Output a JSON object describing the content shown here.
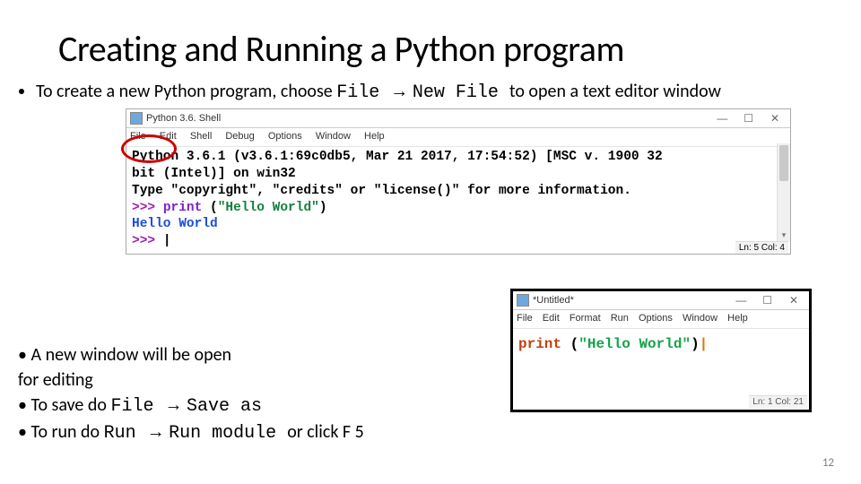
{
  "title": "Creating and Running a Python program",
  "page_number": "12",
  "window_controls": {
    "min": "—",
    "max": "☐",
    "close": "✕"
  },
  "bullets": {
    "top": {
      "prefix": "To create a new Python program, choose ",
      "code1": "File ",
      "arrow": "→",
      "code2": " New File ",
      "suffix": " to open a text editor window"
    },
    "bottom": {
      "0": "A new window will be open",
      "1": "for editing"
    },
    "save": {
      "prefix": "To save do ",
      "code1": "File ",
      "arrow": "→",
      "code2": " Save as"
    },
    "run": {
      "prefix": "To run do ",
      "code1": "Run ",
      "arrow": "→",
      "code2": " Run module ",
      "suffix": " or click F 5"
    }
  },
  "shell": {
    "title": "Python 3.6. Shell",
    "menu": [
      "File",
      "Edit",
      "Shell",
      "Debug",
      "Options",
      "Window",
      "Help"
    ],
    "banner1": "Python 3.6.1 (v3.6.1:69c0db5, Mar 21 2017, 17:54:52) [MSC v. 1900 32",
    "banner2": "bit (Intel)] on win32",
    "banner3": "Type \"copyright\", \"credits\" or \"license()\" for more information.",
    "prompt": ">>>",
    "call_fn": "print",
    "call_open": "(",
    "call_arg": "\"Hello World\"",
    "call_close": ")",
    "output": "Hello World",
    "cursor": "|",
    "status": "Ln: 5  Col: 4"
  },
  "editor": {
    "title": "*Untitled*",
    "menu": [
      "File",
      "Edit",
      "Format",
      "Run",
      "Options",
      "Window",
      "Help"
    ],
    "call_fn": "print",
    "call_open": " (",
    "call_arg": "\"Hello World\"",
    "call_close": ")",
    "cursor": "|",
    "status": "Ln: 1  Col: 21"
  }
}
